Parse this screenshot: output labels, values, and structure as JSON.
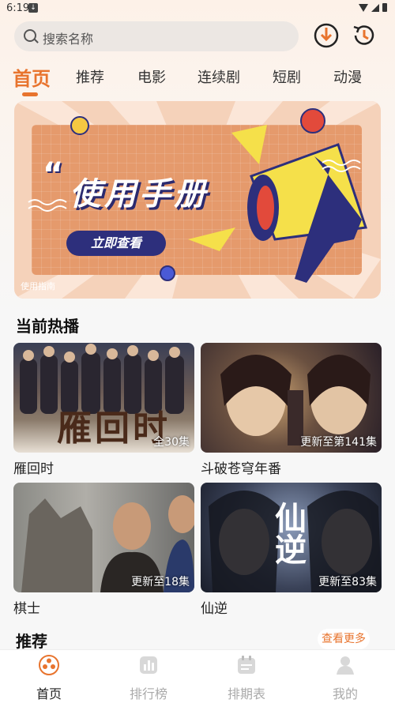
{
  "status": {
    "time": "6:19"
  },
  "search": {
    "placeholder": "搜索名称"
  },
  "tabs": [
    "首页",
    "推荐",
    "电影",
    "连续剧",
    "短剧",
    "动漫"
  ],
  "banner": {
    "quote": "“",
    "title": "使用手册",
    "cta": "立即查看",
    "caption": "使用指南"
  },
  "now_playing": {
    "title": "当前热播",
    "items": [
      {
        "name": "雁回时",
        "badge": "全30集",
        "poster_text": "雁回时"
      },
      {
        "name": "斗破苍穹年番",
        "badge": "更新至第141集"
      },
      {
        "name": "棋士",
        "badge": "更新至18集"
      },
      {
        "name": "仙逆",
        "badge": "更新至83集",
        "poster_text": "仙逆"
      }
    ]
  },
  "recommend": {
    "title": "推荐",
    "more": "查看更多"
  },
  "bottom_nav": [
    "首页",
    "排行榜",
    "排期表",
    "我的"
  ],
  "colors": {
    "accent": "#e8742e",
    "banner_navy": "#2d2f7c"
  }
}
